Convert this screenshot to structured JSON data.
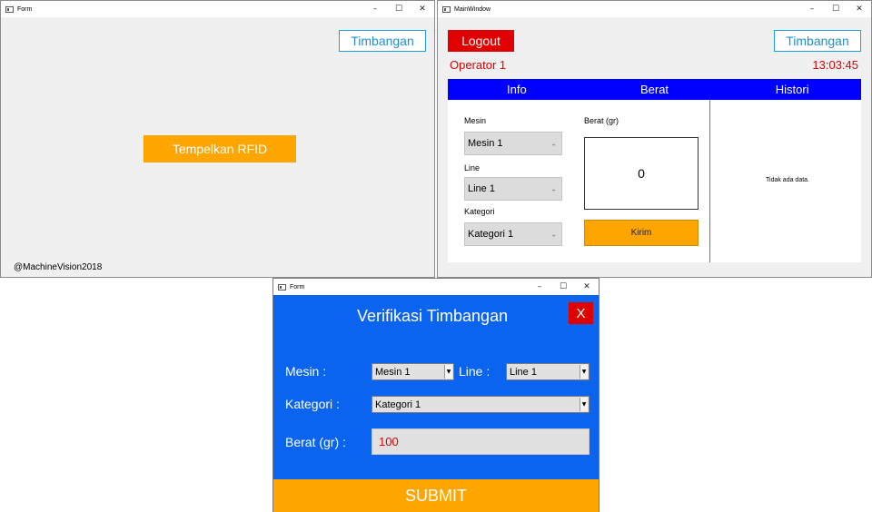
{
  "login_window": {
    "title": "Form",
    "timbangan_label": "Timbangan",
    "rfid_label": "Tempelkan RFID",
    "footer": "@MachineVision2018"
  },
  "main_window": {
    "title": "MainWindow",
    "logout_label": "Logout",
    "timbangan_label": "Timbangan",
    "operator": "Operator 1",
    "clock": "13:03:45",
    "tabs": [
      {
        "label": "Info"
      },
      {
        "label": "Berat"
      },
      {
        "label": "Histori"
      }
    ],
    "mesin_label": "Mesin",
    "mesin_value": "Mesin 1",
    "line_label": "Line",
    "line_value": "Line 1",
    "kategori_label": "Kategori",
    "kategori_value": "Kategori 1",
    "berat_label": "Berat (gr)",
    "berat_value": "0",
    "kirim_label": "Kirim",
    "history_empty": "Tidak ada data."
  },
  "verify_window": {
    "title": "Form",
    "heading": "Verifikasi Timbangan",
    "close_label": "X",
    "mesin_label": "Mesin :",
    "mesin_value": "Mesin 1",
    "line_label": "Line :",
    "line_value": "Line 1",
    "kategori_label": "Kategori :",
    "kategori_value": "Kategori 1",
    "berat_label": "Berat (gr) :",
    "berat_value": "100",
    "submit_label": "SUBMIT"
  },
  "window_controls": {
    "minimize": "–",
    "maximize": "☐",
    "close": "✕"
  },
  "colors": {
    "accent_blue": "#0000ff",
    "verify_blue": "#0a64f0",
    "orange": "#ffa500",
    "red": "#e00000",
    "outline_blue": "#1f9fd8"
  }
}
